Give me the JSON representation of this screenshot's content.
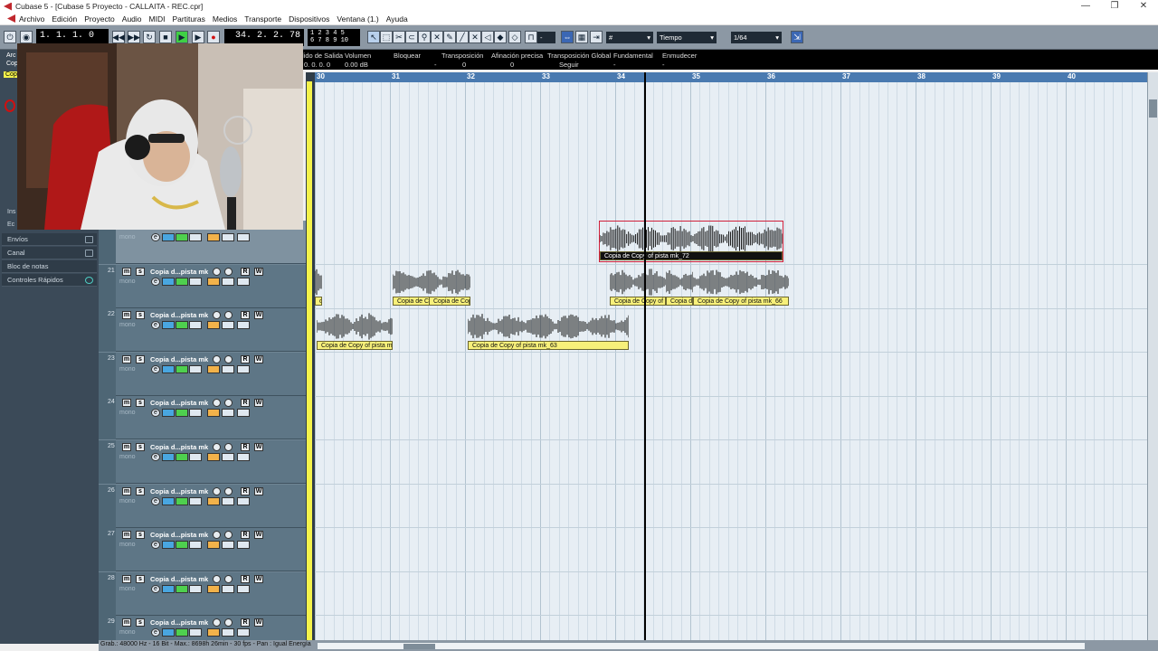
{
  "window": {
    "title": "Cubase 5 - [Cubase 5 Proyecto - CALLAITA - REC.cpr]"
  },
  "menu": [
    "Archivo",
    "Edición",
    "Proyecto",
    "Audio",
    "MIDI",
    "Partituras",
    "Medios",
    "Transporte",
    "Dispositivos",
    "Ventana (1.)",
    "Ayuda"
  ],
  "toolbar": {
    "left_position": "1. 1. 1.   0",
    "right_position": "34. 2. 2. 78",
    "numbers_top": "1 2 3 4 5",
    "numbers_bottom": "6 7 8 9 10",
    "quantize_mode": "Tiempo",
    "quantize_value": "1/64",
    "dash": "-"
  },
  "infoline": {
    "labels": [
      "lido de Salida",
      "Volumen",
      "Bloquear",
      "Transposición",
      "Afinación precisa",
      "Transposición Global",
      "Fundamental",
      "Enmudecer"
    ],
    "values": [
      "0. 0. 0.    0",
      "0.00 dB",
      "-",
      "0",
      "0",
      "Seguir",
      "-",
      "-"
    ]
  },
  "inspector": {
    "rows": [
      "Envíos",
      "Canal",
      "Bloc de notas",
      "Controles Rápidos"
    ],
    "frag_top": [
      "Arc",
      "Cop",
      "Cop"
    ],
    "frag_side": [
      "Ins",
      "Ec"
    ]
  },
  "ruler": {
    "bars": [
      "30",
      "31",
      "32",
      "33",
      "34",
      "35",
      "36",
      "37",
      "38",
      "39",
      "40"
    ]
  },
  "tracks": [
    {
      "number": "",
      "name": "",
      "mono": "mono"
    },
    {
      "number": "21",
      "name": "Copia d...pista mk",
      "mono": "mono"
    },
    {
      "number": "22",
      "name": "Copia d...pista mk",
      "mono": "mono"
    },
    {
      "number": "23",
      "name": "Copia d...pista mk",
      "mono": "mono"
    },
    {
      "number": "24",
      "name": "Copia d...pista mk",
      "mono": "mono"
    },
    {
      "number": "25",
      "name": "Copia d...pista mk",
      "mono": "mono"
    },
    {
      "number": "26",
      "name": "Copia d...pista mk",
      "mono": "mono"
    },
    {
      "number": "27",
      "name": "Copia d...pista mk",
      "mono": "mono"
    },
    {
      "number": "28",
      "name": "Copia d...pista mk",
      "mono": "mono"
    },
    {
      "number": "29",
      "name": "Copia d...pista mk",
      "mono": "mono"
    }
  ],
  "button_letters": {
    "m": "m",
    "s": "s",
    "r": "R",
    "w": "W",
    "e": "e"
  },
  "events": [
    {
      "label": "Copia de Copy of pista mk_72",
      "selected": true
    },
    {
      "label": "Copia de Copy of pista mk_",
      "selected": false
    },
    {
      "label": "Copia de Copy of pista mk_",
      "selected": false
    },
    {
      "label": "Copia de Copy of pista mk_66",
      "selected": false
    },
    {
      "label": "Copia de Copy of pista mk_",
      "selected": false
    },
    {
      "label": "Copia de Copy of pista mk_",
      "selected": false
    },
    {
      "label": "Copia de Copy of pista mk_",
      "selected": false
    },
    {
      "label": "Copia de Copy of pista mk_63",
      "selected": false
    },
    {
      "label": "of",
      "selected": false
    }
  ],
  "status": {
    "text": "Grab.: 48000 Hz - 16 Bit - Max.: 8698h 26min - 30 fps - Pan : Igual Energía"
  },
  "colors": {
    "event_label": "#f7f07a",
    "selected_border": "#d0203a",
    "ruler": "#4a7ab0"
  }
}
